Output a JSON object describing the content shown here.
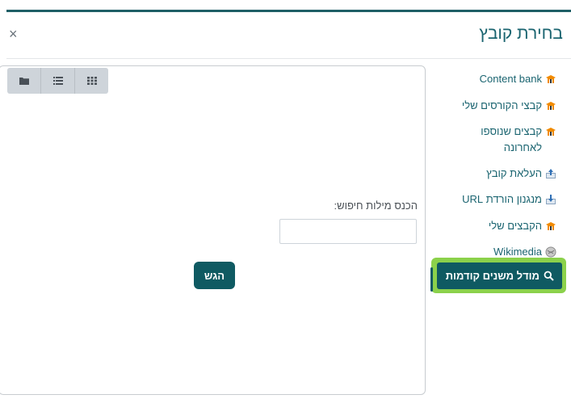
{
  "dialog": {
    "title": "בחירת קובץ",
    "close_symbol": "×"
  },
  "view_buttons": [
    {
      "icon": "folder-icon"
    },
    {
      "icon": "list-view-icon"
    },
    {
      "icon": "grid-view-icon"
    }
  ],
  "search": {
    "label": "הכנס מילות חיפוש:",
    "value": "",
    "placeholder": "",
    "submit_label": "הגש"
  },
  "sidebar": {
    "items": [
      {
        "label": "Content bank",
        "icon": "moodle-hat-icon"
      },
      {
        "label": "קבצי הקורסים שלי",
        "icon": "moodle-hat-icon"
      },
      {
        "label": "קבצים שנוספו לאחרונה",
        "icon": "moodle-hat-icon"
      },
      {
        "label": "העלאת קובץ",
        "icon": "upload-icon"
      },
      {
        "label": "מנגנון הורדת URL",
        "icon": "download-icon"
      },
      {
        "label": "הקבצים שלי",
        "icon": "moodle-hat-icon"
      },
      {
        "label": "Wikimedia",
        "icon": "wikimedia-icon"
      },
      {
        "label": "מודל משנים קודמות",
        "icon": "search-icon"
      }
    ]
  },
  "colors": {
    "accent": "#0f5a62",
    "highlight": "#8bd14b",
    "title": "#1a6470"
  }
}
